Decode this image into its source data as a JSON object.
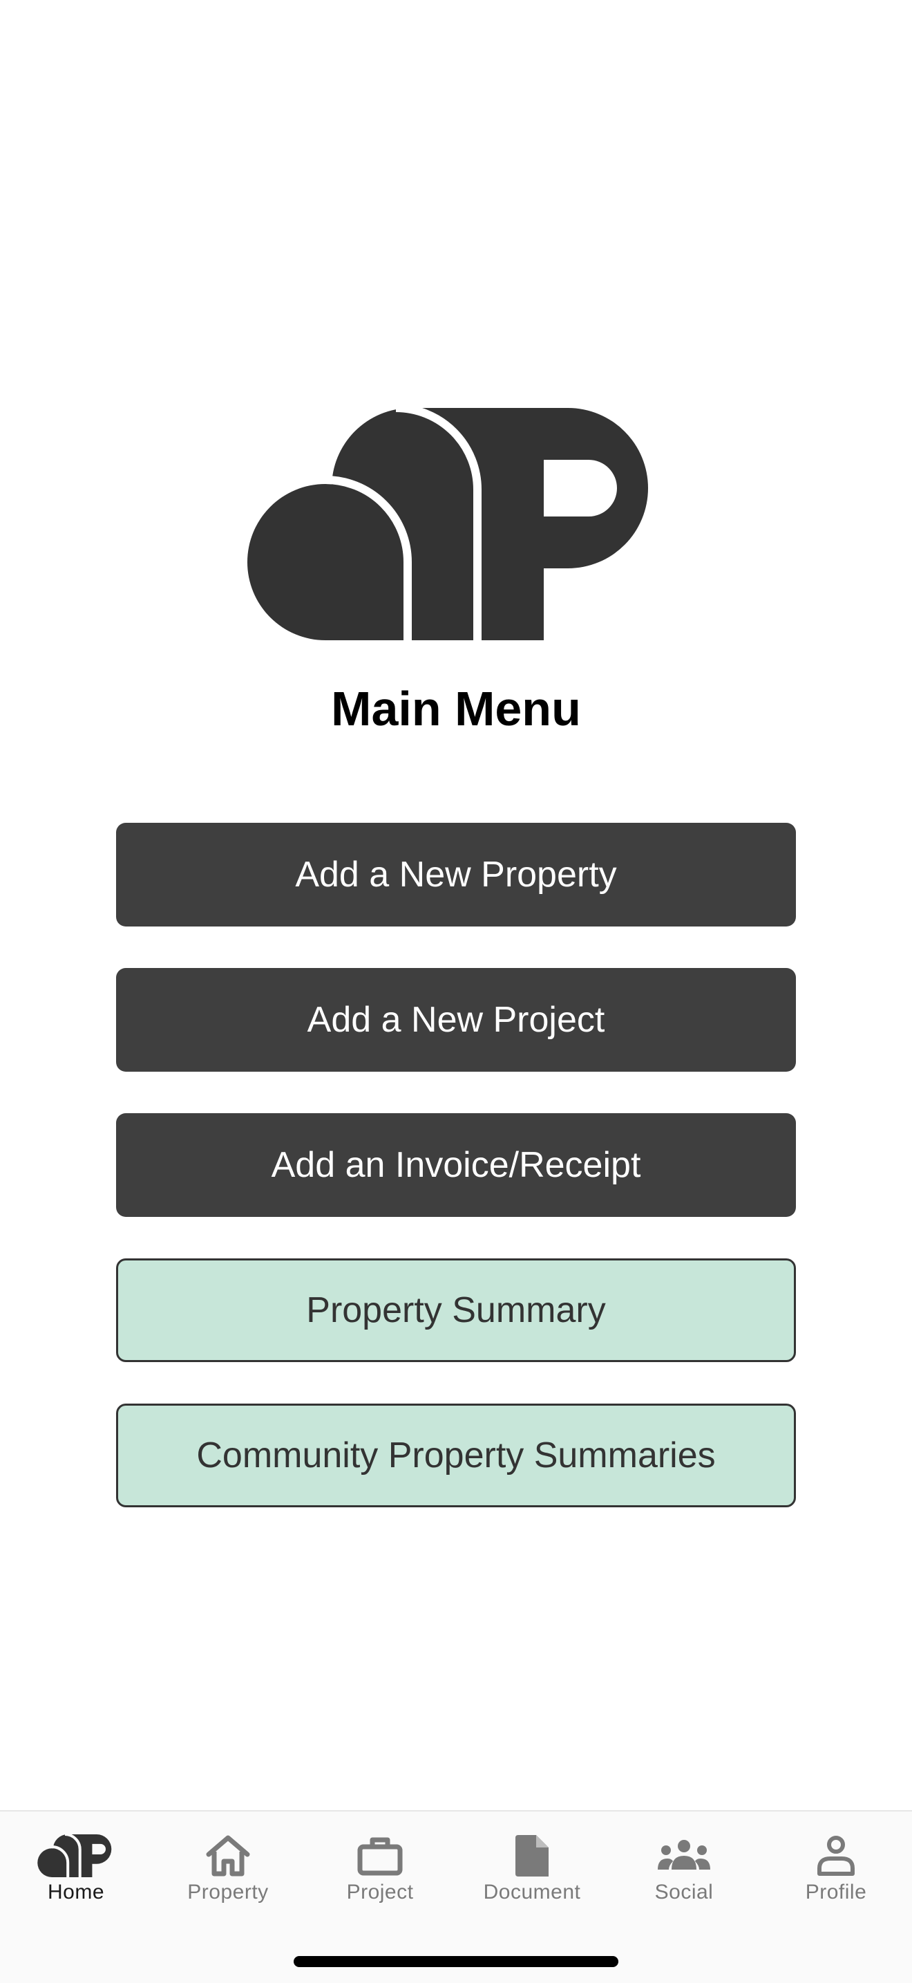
{
  "page": {
    "title": "Main Menu"
  },
  "menu": {
    "buttons": [
      {
        "label": "Add a New Property",
        "style": "dark"
      },
      {
        "label": "Add a New Project",
        "style": "dark"
      },
      {
        "label": "Add an Invoice/Receipt",
        "style": "dark"
      },
      {
        "label": "Property Summary",
        "style": "light"
      },
      {
        "label": "Community Property Summaries",
        "style": "light"
      }
    ]
  },
  "tabbar": {
    "tabs": [
      {
        "label": "Home",
        "icon": "app-logo-icon",
        "active": true
      },
      {
        "label": "Property",
        "icon": "house-icon",
        "active": false
      },
      {
        "label": "Project",
        "icon": "briefcase-icon",
        "active": false
      },
      {
        "label": "Document",
        "icon": "document-icon",
        "active": false
      },
      {
        "label": "Social",
        "icon": "people-icon",
        "active": false
      },
      {
        "label": "Profile",
        "icon": "person-icon",
        "active": false
      }
    ]
  },
  "colors": {
    "primary_dark": "#3f3f3f",
    "accent_mint": "#c7e6d9",
    "tab_active": "#1a1a1a",
    "tab_inactive": "#7a7a7a"
  }
}
